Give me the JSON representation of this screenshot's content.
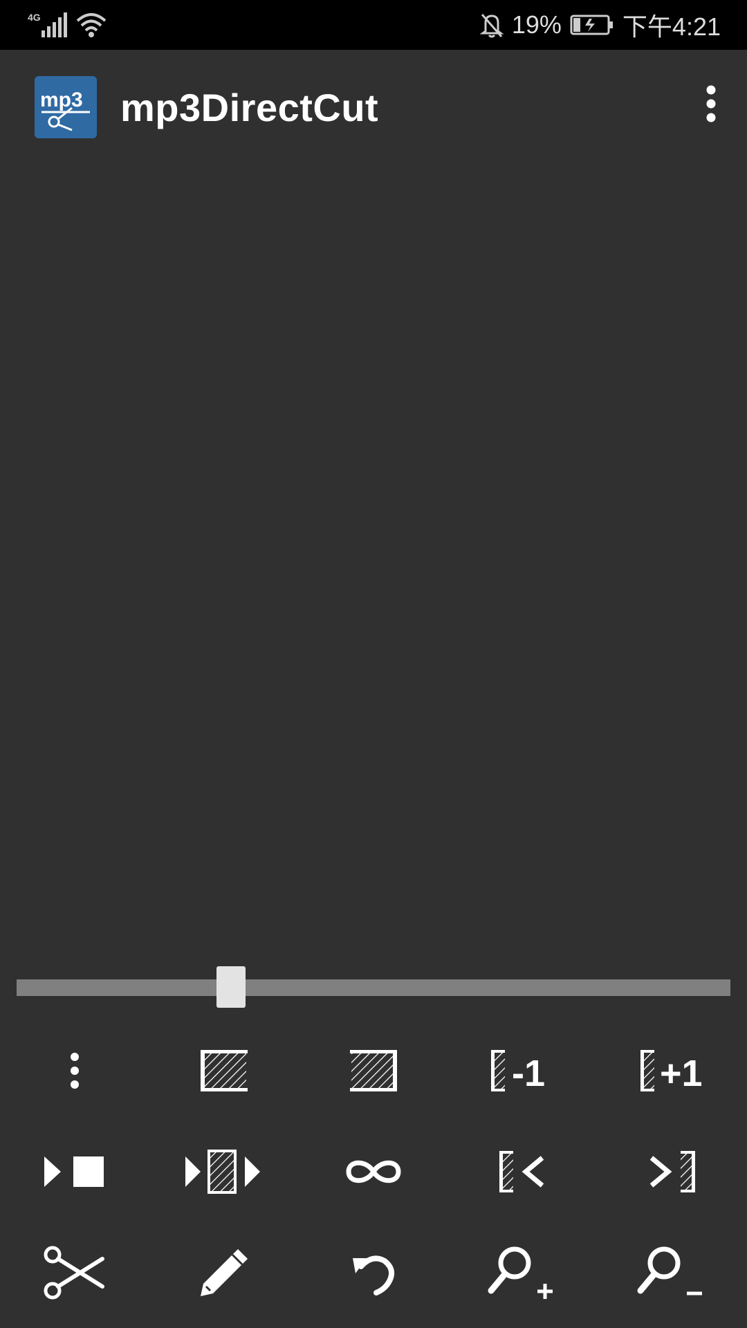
{
  "status_bar": {
    "network": "4G",
    "battery_percent": "19%",
    "time": "下午4:21",
    "icons": [
      "signal-icon",
      "wifi-icon",
      "bell-off-icon",
      "battery-charging-icon"
    ]
  },
  "app_bar": {
    "title": "mp3DirectCut",
    "logo_text": "mp3",
    "icons": [
      "app-logo-icon",
      "overflow-menu-icon"
    ]
  },
  "seekbar": {
    "position_fraction": 0.3
  },
  "toolbar": {
    "rows": [
      [
        "more-vertical-icon",
        "select-all-icon",
        "select-region-icon",
        "move-minus-one-icon",
        "move-plus-one-icon"
      ],
      [
        "play-stop-icon",
        "play-selection-icon",
        "loop-icon",
        "go-to-start-icon",
        "go-to-end-icon"
      ],
      [
        "cut-icon",
        "edit-icon",
        "undo-icon",
        "zoom-in-icon",
        "zoom-out-icon"
      ]
    ],
    "labels": {
      "minus_one": "-1",
      "plus_one": "+1"
    }
  },
  "colors": {
    "background": "#303030",
    "status_bar": "#000000",
    "app_icon": "#2f6aa3",
    "seek_track": "#808080",
    "seek_thumb": "#e3e3e3",
    "icon": "#ffffff"
  }
}
